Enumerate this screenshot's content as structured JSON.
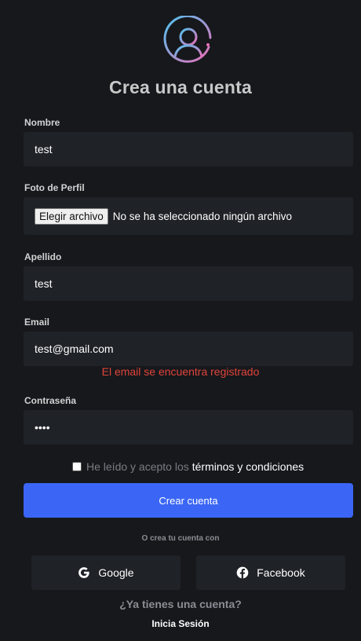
{
  "form": {
    "title": "Crea una cuenta",
    "nombre_label": "Nombre",
    "nombre_value": "test",
    "foto_label": "Foto de Perfil",
    "file_button": "Elegir archivo",
    "file_status": "No se ha seleccionado ningún archivo",
    "apellido_label": "Apellido",
    "apellido_value": "test",
    "email_label": "Email",
    "email_value": "test@gmail.com",
    "email_error": "El email se encuentra registrado",
    "password_label": "Contraseña",
    "password_value": "••••",
    "terms_text": "He leído y acepto los",
    "terms_link": "términos y condiciones",
    "submit_label": "Crear cuenta",
    "or_text": "O crea tu cuenta con",
    "google_label": "Google",
    "facebook_label": "Facebook",
    "have_account": "¿Ya tienes una cuenta?",
    "login_link": "Inicia Sesión"
  },
  "colors": {
    "background": "#16181c",
    "field": "#1f2227",
    "primary": "#3b66f5",
    "error": "#e0443a",
    "logo_gradient_start": "#4fc3ef",
    "logo_gradient_end": "#e86fb7"
  },
  "icons": {
    "logo": "user-circle-icon",
    "google": "google-icon",
    "facebook": "facebook-icon"
  }
}
